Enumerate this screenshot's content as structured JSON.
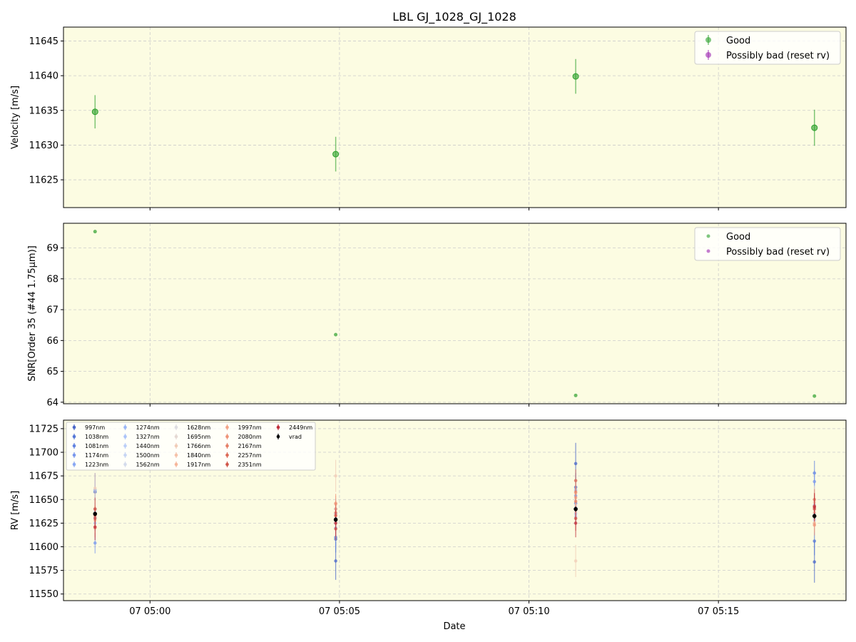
{
  "colors": {
    "good": "#2ca02c",
    "bad": "#9c27b0",
    "panel_bg": "#fcfce2",
    "grid": "#cccccc",
    "vrad": "#000000"
  },
  "chart_data": [
    {
      "type": "scatter",
      "title": "LBL GJ_1028_GJ_1028",
      "xlabel": "",
      "ylabel": "Velocity [m/s]",
      "xlim": [
        "07 04:57:43",
        "07 05:18:22"
      ],
      "ylim": [
        11621,
        11647
      ],
      "yticks": [
        11625,
        11630,
        11635,
        11640,
        11645
      ],
      "x_tick_labels": [],
      "legend": {
        "placement": "top-right",
        "entries": [
          "Good",
          "Possibly bad (reset rv)"
        ]
      },
      "grid": true,
      "series": [
        {
          "name": "Good",
          "x": [
            "07 04:58:33",
            "07 05:04:54",
            "07 05:11:14",
            "07 05:17:32"
          ],
          "y": [
            11634.8,
            11628.7,
            11639.9,
            11632.5
          ],
          "yerr": [
            2.4,
            2.5,
            2.5,
            2.6
          ]
        },
        {
          "name": "Possibly bad (reset rv)",
          "x": [],
          "y": [],
          "yerr": []
        }
      ]
    },
    {
      "type": "scatter",
      "xlabel": "",
      "ylabel": "SNR[Order 35 (#44 1.75μm)]",
      "xlim": [
        "07 04:57:43",
        "07 05:18:22"
      ],
      "ylim": [
        63.95,
        69.8
      ],
      "yticks": [
        64,
        65,
        66,
        67,
        68,
        69
      ],
      "x_tick_labels": [],
      "legend": {
        "placement": "top-right",
        "entries": [
          "Good",
          "Possibly bad (reset rv)"
        ]
      },
      "grid": true,
      "series": [
        {
          "name": "Good",
          "x": [
            "07 04:58:33",
            "07 05:04:54",
            "07 05:11:14",
            "07 05:17:32"
          ],
          "y": [
            69.53,
            66.19,
            64.22,
            64.2
          ]
        },
        {
          "name": "Possibly bad (reset rv)",
          "x": [],
          "y": []
        }
      ]
    },
    {
      "type": "scatter",
      "xlabel": "Date",
      "ylabel": "RV [m/s]",
      "xlim": [
        "07 04:57:43",
        "07 05:18:22"
      ],
      "ylim": [
        11543,
        11734
      ],
      "yticks": [
        11550,
        11575,
        11600,
        11625,
        11650,
        11675,
        11700,
        11725
      ],
      "x_tick_labels": [
        "07 05:00",
        "07 05:05",
        "07 05:10",
        "07 05:15"
      ],
      "x_tick_values": [
        "07 05:00:00",
        "07 05:05:00",
        "07 05:10:00",
        "07 05:15:00"
      ],
      "legend": {
        "placement": "top-left"
      },
      "grid": true,
      "x": [
        "07 04:58:33",
        "07 05:04:54",
        "07 05:11:14",
        "07 05:17:32"
      ],
      "series": [
        {
          "name": "997nm",
          "color": "#4a67c9",
          "y": [
            11658,
            11585,
            11688,
            11584
          ],
          "yerr": [
            20,
            20,
            22,
            22
          ]
        },
        {
          "name": "1038nm",
          "color": "#5577d6",
          "y": [
            11631,
            11608,
            11663,
            11606
          ],
          "yerr": [
            14,
            14,
            15,
            15
          ]
        },
        {
          "name": "1081nm",
          "color": "#6283e0",
          "y": [
            11640,
            11610,
            11646,
            11678
          ],
          "yerr": [
            12,
            12,
            13,
            13
          ]
        },
        {
          "name": "1174nm",
          "color": "#7a98ec",
          "y": [
            11604,
            11640,
            11654,
            11669
          ],
          "yerr": [
            11,
            11,
            12,
            12
          ]
        },
        {
          "name": "1223nm",
          "color": "#8aa8f3",
          "y": [
            11660,
            11635,
            11641,
            11640
          ],
          "yerr": [
            10,
            10,
            11,
            11
          ]
        },
        {
          "name": "1274nm",
          "color": "#9bb7f7",
          "y": [
            11640,
            11620,
            11660,
            11635
          ],
          "yerr": [
            9,
            9,
            10,
            10
          ]
        },
        {
          "name": "1327nm",
          "color": "#abc3f9",
          "y": [
            11625,
            11629,
            11635,
            11644
          ],
          "yerr": [
            9,
            9,
            10,
            10
          ]
        },
        {
          "name": "1440nm",
          "color": "#bccff8",
          "y": [
            11630,
            11625,
            11632,
            11630
          ],
          "yerr": [
            8,
            8,
            9,
            9
          ]
        },
        {
          "name": "1500nm",
          "color": "#c8d6f4",
          "y": [
            11637,
            11630,
            11640,
            11628
          ],
          "yerr": [
            8,
            8,
            9,
            9
          ]
        },
        {
          "name": "1562nm",
          "color": "#d4dbec",
          "y": [
            11633,
            11627,
            11638,
            11632
          ],
          "yerr": [
            8,
            8,
            9,
            9
          ]
        },
        {
          "name": "1628nm",
          "color": "#dedde2",
          "y": [
            11636,
            11630,
            11644,
            11636
          ],
          "yerr": [
            8,
            8,
            9,
            9
          ]
        },
        {
          "name": "1695nm",
          "color": "#e5d9d3",
          "y": [
            11632,
            11626,
            11637,
            11630
          ],
          "yerr": [
            8,
            8,
            9,
            9
          ]
        },
        {
          "name": "1766nm",
          "color": "#f1cdb8",
          "y": [
            11662,
            11675,
            11585,
            11647
          ],
          "yerr": [
            16,
            17,
            17,
            17
          ]
        },
        {
          "name": "1840nm",
          "color": "#f5c2a9",
          "y": [
            11640,
            11645,
            11640,
            11636
          ],
          "yerr": [
            9,
            9,
            10,
            10
          ]
        },
        {
          "name": "1917nm",
          "color": "#f6b69a",
          "y": [
            11628,
            11633,
            11657,
            11625
          ],
          "yerr": [
            9,
            9,
            10,
            10
          ]
        },
        {
          "name": "1997nm",
          "color": "#f3a488",
          "y": [
            11635,
            11640,
            11652,
            11640
          ],
          "yerr": [
            9,
            9,
            10,
            10
          ]
        },
        {
          "name": "2080nm",
          "color": "#ee9377",
          "y": [
            11620,
            11646,
            11658,
            11623
          ],
          "yerr": [
            10,
            10,
            11,
            11
          ]
        },
        {
          "name": "2167nm",
          "color": "#e58067",
          "y": [
            11633,
            11636,
            11648,
            11650
          ],
          "yerr": [
            10,
            10,
            11,
            11
          ]
        },
        {
          "name": "2257nm",
          "color": "#dc6b57",
          "y": [
            11630,
            11633,
            11670,
            11640
          ],
          "yerr": [
            11,
            11,
            12,
            12
          ]
        },
        {
          "name": "2351nm",
          "color": "#d05548",
          "y": [
            11640,
            11619,
            11630,
            11643
          ],
          "yerr": [
            12,
            12,
            13,
            13
          ]
        },
        {
          "name": "2449nm",
          "color": "#c0303d",
          "y": [
            11621,
            11625,
            11625,
            11642
          ],
          "yerr": [
            14,
            14,
            15,
            15
          ]
        },
        {
          "name": "vrad",
          "color": "#000000",
          "y": [
            11634.8,
            11628.7,
            11639.9,
            11632.5
          ],
          "yerr": [
            2.4,
            2.5,
            2.5,
            2.6
          ]
        }
      ]
    }
  ]
}
